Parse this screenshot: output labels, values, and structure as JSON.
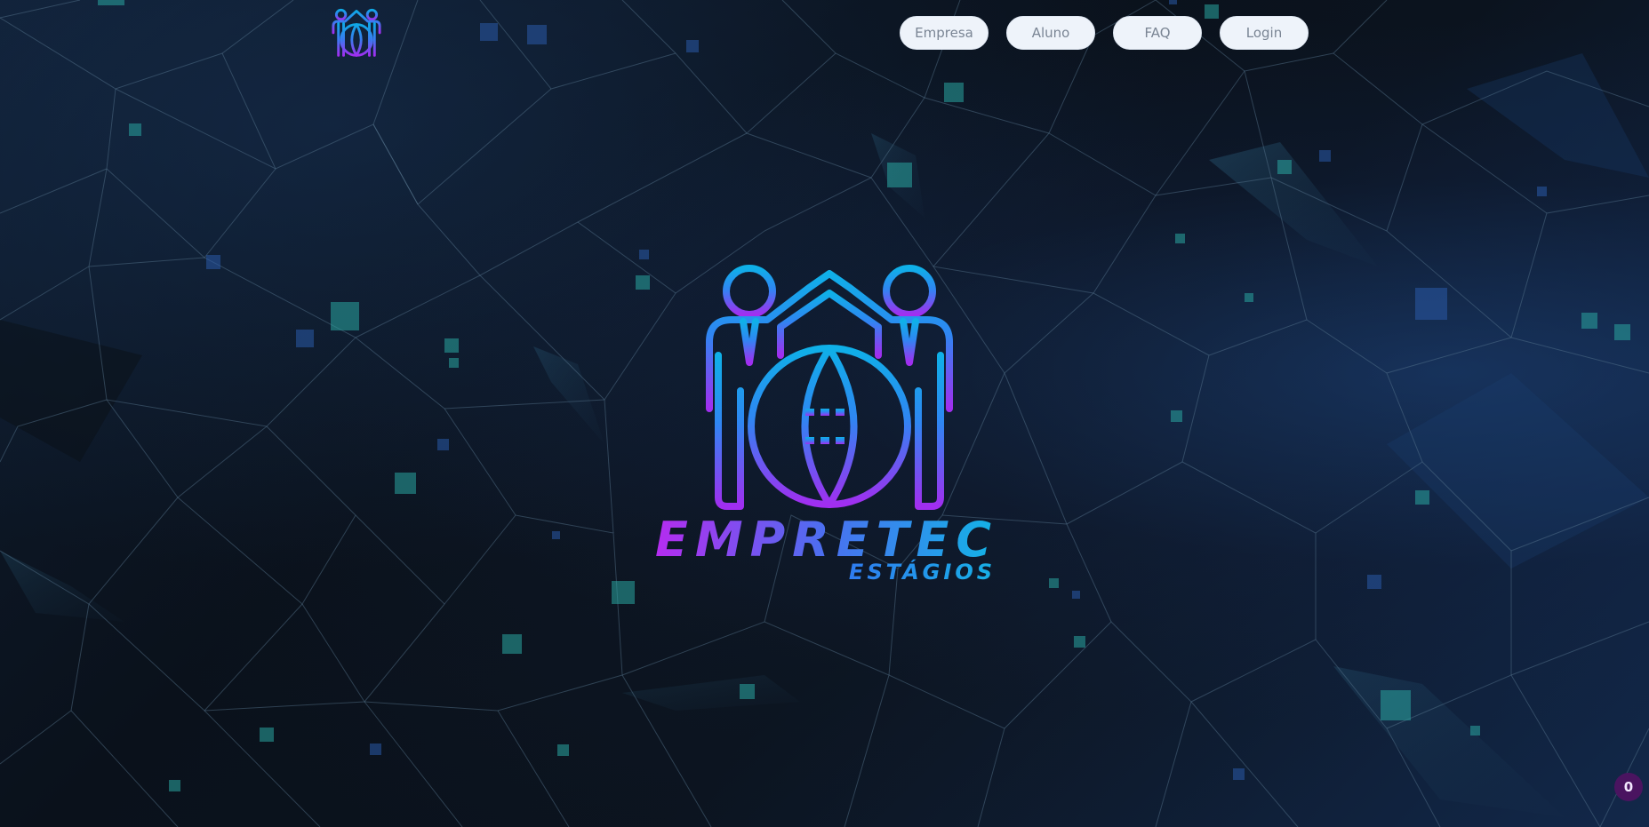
{
  "nav": {
    "empresa_label": "Empresa",
    "aluno_label": "Aluno",
    "faq_label": "FAQ",
    "login_label": "Login"
  },
  "hero": {
    "brand_name": "EMPRETEC",
    "brand_tagline": "ESTÁGIOS",
    "logo_icon": "business-partners-globe-icon"
  },
  "header": {
    "logo_icon": "business-partners-globe-icon"
  },
  "badge": {
    "count": "0"
  },
  "colors": {
    "logo_gradient_top": "#0fa9e6",
    "logo_gradient_mid": "#3a7bf0",
    "logo_gradient_bottom": "#a12ef0",
    "nav_button_bg": "#eef3fa",
    "nav_button_text": "#7a8594",
    "page_background": "#0b1018",
    "badge_bg": "#4a1460"
  }
}
